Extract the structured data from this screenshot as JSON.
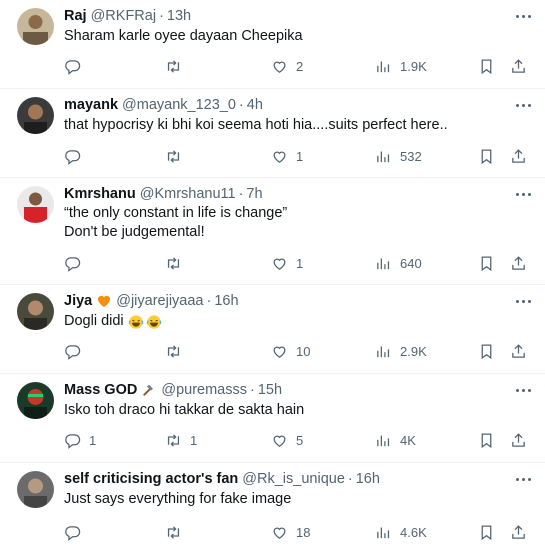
{
  "tweets": [
    {
      "name": "Raj",
      "handle": "@RKFRaj",
      "time": "13h",
      "lines": [
        "Sharam karle oyee dayaan Cheepika"
      ],
      "replies": "",
      "retweets": "",
      "likes": "2",
      "views": "1.9K"
    },
    {
      "name": "mayank",
      "handle": "@mayank_123_0",
      "time": "4h",
      "lines": [
        "that hypocrisy ki bhi koi seema hoti hia....suits perfect here.."
      ],
      "replies": "",
      "retweets": "",
      "likes": "1",
      "views": "532"
    },
    {
      "name": "Kmrshanu",
      "handle": "@Kmrshanu11",
      "time": "7h",
      "lines": [
        "“the only constant in life is change”",
        "Don't be judgemental!"
      ],
      "replies": "",
      "retweets": "",
      "likes": "1",
      "views": "640"
    },
    {
      "name": "Jiya",
      "name_emoji": "orange-heart",
      "handle": "@jiyarejiyaaa",
      "time": "16h",
      "lines": [
        "Dogli didi"
      ],
      "line_emoji": "laughing-tears x2",
      "replies": "",
      "retweets": "",
      "likes": "10",
      "views": "2.9K"
    },
    {
      "name": "Mass GOD",
      "name_emoji": "hammer",
      "handle": "@puremasss",
      "time": "15h",
      "lines": [
        "Isko toh draco hi takkar de sakta hain"
      ],
      "replies": "1",
      "retweets": "1",
      "likes": "5",
      "views": "4K"
    },
    {
      "name": "self criticising actor's fan",
      "handle": "@Rk_is_unique",
      "time": "16h",
      "lines": [
        "Just says everything for fake image"
      ],
      "replies": "",
      "retweets": "",
      "likes": "18",
      "views": "4.6K"
    }
  ],
  "colors": {
    "text": "#0f1419",
    "secondary": "#536471",
    "divider": "#eff3f4",
    "heart_orange": "#f4900c"
  }
}
